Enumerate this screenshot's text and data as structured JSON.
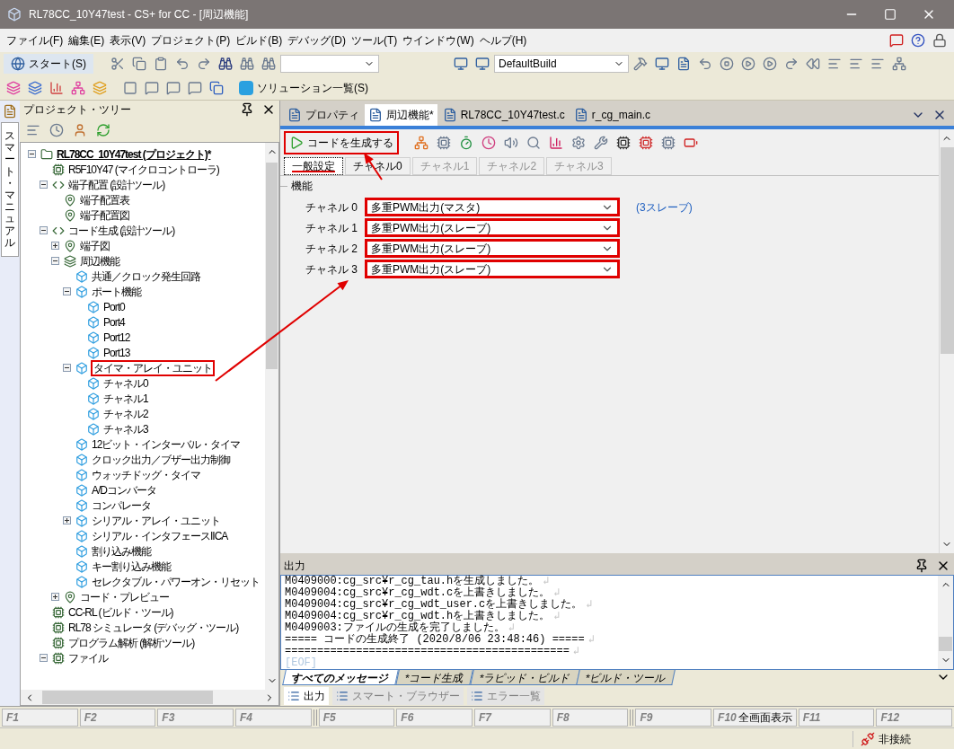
{
  "window": {
    "title": "RL78CC_10Y47test - CS+ for CC - [周辺機能]"
  },
  "menu": [
    "ファイル(F)",
    "編集(E)",
    "表示(V)",
    "プロジェクト(P)",
    "ビルド(B)",
    "デバッグ(D)",
    "ツール(T)",
    "ウインドウ(W)",
    "ヘルプ(H)"
  ],
  "toolbar": {
    "start": "スタート(S)",
    "build_mode": "DefaultBuild",
    "solution": "ソリューション一覧(S)"
  },
  "project_tree": {
    "title": "プロジェクト・ツリー",
    "side_tab": "スマート・マニュアル",
    "nodes": [
      {
        "label": "RL78CC_10Y47test (プロジェクト)*",
        "expanded": true,
        "children": [
          {
            "label": "R5F10Y47 (マイクロコントローラ)"
          },
          {
            "label": "端子配置 (設計ツール)",
            "expanded": true,
            "children": [
              {
                "label": "端子配置表"
              },
              {
                "label": "端子配置図"
              }
            ]
          },
          {
            "label": "コード生成 (設計ツール)",
            "expanded": true,
            "children": [
              {
                "label": "端子図",
                "expanded": false
              },
              {
                "label": "周辺機能",
                "expanded": true,
                "children": [
                  {
                    "label": "共通／クロック発生回路"
                  },
                  {
                    "label": "ポート機能",
                    "expanded": true,
                    "children": [
                      {
                        "label": "Port0"
                      },
                      {
                        "label": "Port4"
                      },
                      {
                        "label": "Port12"
                      },
                      {
                        "label": "Port13"
                      }
                    ]
                  },
                  {
                    "label": "タイマ・アレイ・ユニット",
                    "expanded": true,
                    "annotated": true,
                    "children": [
                      {
                        "label": "チャネル0"
                      },
                      {
                        "label": "チャネル1"
                      },
                      {
                        "label": "チャネル2"
                      },
                      {
                        "label": "チャネル3"
                      }
                    ]
                  },
                  {
                    "label": "12ビット・インターバル・タイマ"
                  },
                  {
                    "label": "クロック出力／ブザー出力制御"
                  },
                  {
                    "label": "ウォッチドッグ・タイマ"
                  },
                  {
                    "label": "A/Dコンバータ"
                  },
                  {
                    "label": "コンパレータ"
                  },
                  {
                    "label": "シリアル・アレイ・ユニット",
                    "expanded": false
                  },
                  {
                    "label": "シリアル・インタフェースIICA"
                  },
                  {
                    "label": "割り込み機能"
                  },
                  {
                    "label": "キー割り込み機能"
                  },
                  {
                    "label": "セレクタブル・パワーオン・リセット"
                  }
                ]
              },
              {
                "label": "コード・プレビュー",
                "expanded": false
              }
            ]
          },
          {
            "label": "CC-RL (ビルド・ツール)"
          },
          {
            "label": "RL78 シミュレータ (デバッグ・ツール)"
          },
          {
            "label": "プログラム解析 (解析ツール)"
          },
          {
            "label": "ファイル",
            "expanded": true
          }
        ]
      }
    ]
  },
  "editor": {
    "tabs": [
      {
        "label": "プロパティ",
        "selected": false
      },
      {
        "label": "周辺機能*",
        "selected": true
      },
      {
        "label": "RL78CC_10Y47test.c",
        "selected": false
      },
      {
        "label": "r_cg_main.c",
        "selected": false
      }
    ],
    "generate_button": {
      "label": "コードを生成する",
      "annotated": true
    },
    "subtabs": [
      {
        "label": "一般設定",
        "selected": true,
        "disabled": false
      },
      {
        "label": "チャネル0",
        "selected": false,
        "disabled": false
      },
      {
        "label": "チャネル1",
        "selected": false,
        "disabled": true
      },
      {
        "label": "チャネル2",
        "selected": false,
        "disabled": true
      },
      {
        "label": "チャネル3",
        "selected": false,
        "disabled": true
      }
    ],
    "section": "機能",
    "channels": [
      {
        "label": "チャネル 0",
        "value": "多重PWM出力(マスタ)",
        "note": "(3スレーブ)",
        "annotated": true
      },
      {
        "label": "チャネル 1",
        "value": "多重PWM出力(スレーブ)",
        "annotated": true
      },
      {
        "label": "チャネル 2",
        "value": "多重PWM出力(スレーブ)",
        "annotated": true
      },
      {
        "label": "チャネル 3",
        "value": "多重PWM出力(スレーブ)",
        "annotated": true
      }
    ]
  },
  "output": {
    "title": "出力",
    "eol_mark": "↲",
    "lines": [
      "M0409000:cg_src¥r_cg_tau.hを生成しました。",
      "M0409004:cg_src¥r_cg_wdt.cを上書きしました。",
      "M0409004:cg_src¥r_cg_wdt_user.cを上書きしました。",
      "M0409004:cg_src¥r_cg_wdt.hを上書きしました。",
      "M0409003:ファイルの生成を完了しました。",
      "===== コードの生成終了 (2020/8/06 23:48:46) =====",
      "============================================"
    ],
    "eof": "[EOF]",
    "tabs": [
      {
        "label": "すべてのメッセージ",
        "selected": true
      },
      {
        "label": "*コード生成",
        "selected": false
      },
      {
        "label": "*ラピッド・ビルド",
        "selected": false
      },
      {
        "label": "*ビルド・ツール",
        "selected": false
      }
    ],
    "panels": [
      {
        "label": "出力",
        "selected": true
      },
      {
        "label": "スマート・ブラウザー",
        "selected": false
      },
      {
        "label": "エラー一覧",
        "selected": false
      }
    ]
  },
  "function_keys": [
    {
      "key": "F1"
    },
    {
      "key": "F2"
    },
    {
      "key": "F3"
    },
    {
      "key": "F4"
    },
    {
      "key": "F5"
    },
    {
      "key": "F6"
    },
    {
      "key": "F7"
    },
    {
      "key": "F8"
    },
    {
      "key": "F9"
    },
    {
      "key": "F10",
      "label": "全画面表示"
    },
    {
      "key": "F11"
    },
    {
      "key": "F12"
    }
  ],
  "status": "非接続"
}
